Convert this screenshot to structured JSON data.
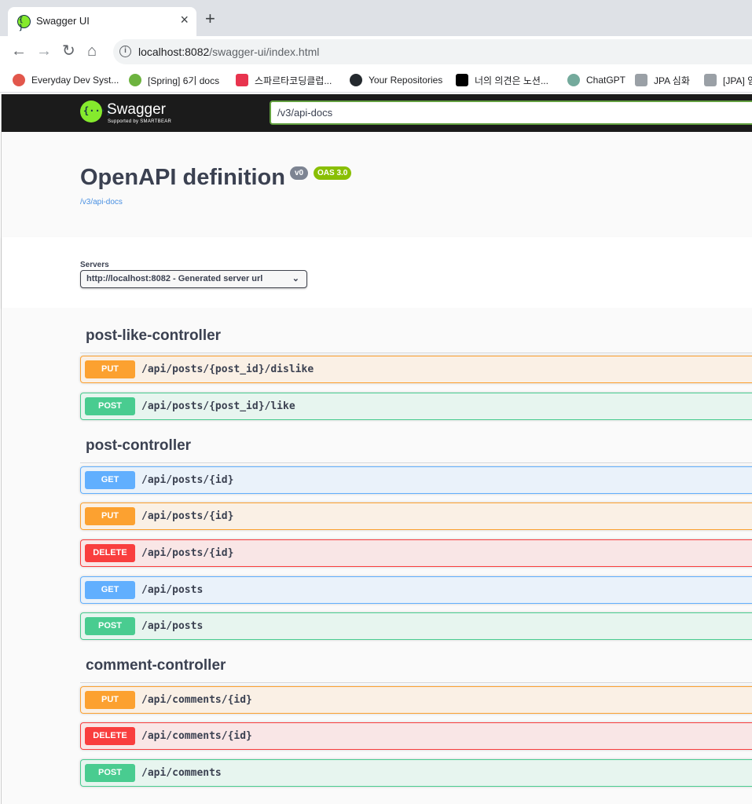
{
  "browser": {
    "tab_title": "Swagger UI",
    "tab_close": "×",
    "new_tab": "+",
    "url_host": "localhost:8082",
    "url_path": "/swagger-ui/index.html",
    "back": "←",
    "forward": "→",
    "reload": "↻",
    "home": "⌂",
    "info": "i"
  },
  "bookmarks": [
    {
      "label": "Everyday Dev Syst...",
      "color": "#e2574c"
    },
    {
      "label": "[Spring] 6기 docs",
      "color": "#6db33f"
    },
    {
      "label": "스파르타코딩클럽...",
      "color": "#e8344e"
    },
    {
      "label": "Your Repositories",
      "color": "#24292e"
    },
    {
      "label": "너의 의견은 노션...",
      "color": "#000000"
    },
    {
      "label": "ChatGPT",
      "color": "#74aa9c"
    },
    {
      "label": "JPA 심화",
      "color": "#9aa0a6"
    },
    {
      "label": "[JPA] 임",
      "color": "#9aa0a6"
    }
  ],
  "topbar": {
    "logo_text": "Swagger",
    "logo_sub": "Supported by SMARTBEAR",
    "spec_url": "/v3/api-docs"
  },
  "info": {
    "title": "OpenAPI definition",
    "version": "v0",
    "oas": "OAS 3.0",
    "spec_link": "/v3/api-docs"
  },
  "servers": {
    "label": "Servers",
    "selected": "http://localhost:8082 - Generated server url"
  },
  "tags": [
    {
      "name": "post-like-controller",
      "operations": [
        {
          "method": "PUT",
          "path": "/api/posts/{post_id}/dislike"
        },
        {
          "method": "POST",
          "path": "/api/posts/{post_id}/like"
        }
      ]
    },
    {
      "name": "post-controller",
      "operations": [
        {
          "method": "GET",
          "path": "/api/posts/{id}"
        },
        {
          "method": "PUT",
          "path": "/api/posts/{id}"
        },
        {
          "method": "DELETE",
          "path": "/api/posts/{id}"
        },
        {
          "method": "GET",
          "path": "/api/posts"
        },
        {
          "method": "POST",
          "path": "/api/posts"
        }
      ]
    },
    {
      "name": "comment-controller",
      "operations": [
        {
          "method": "PUT",
          "path": "/api/comments/{id}"
        },
        {
          "method": "DELETE",
          "path": "/api/comments/{id}"
        },
        {
          "method": "POST",
          "path": "/api/comments"
        }
      ]
    }
  ]
}
